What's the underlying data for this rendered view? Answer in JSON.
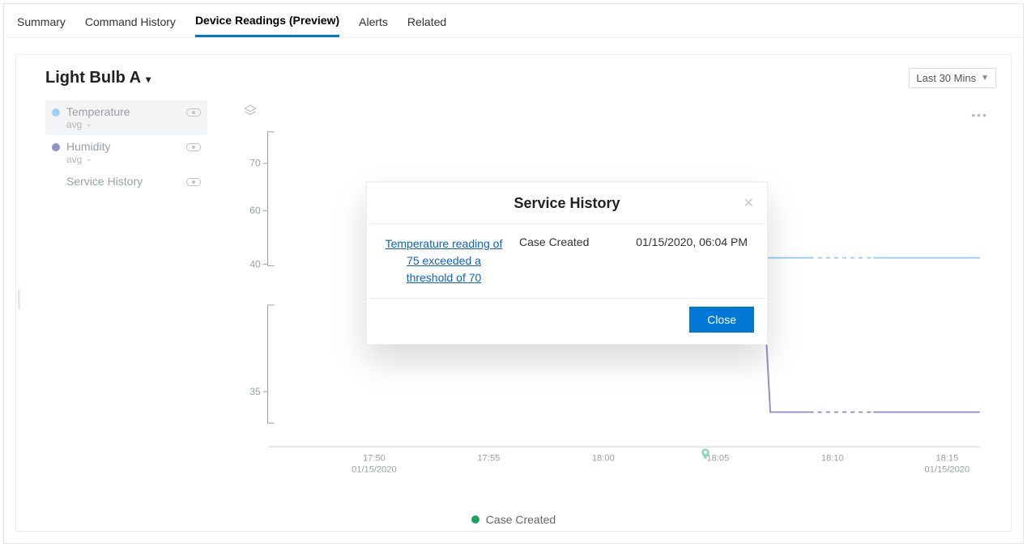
{
  "tabs": [
    {
      "label": "Summary"
    },
    {
      "label": "Command History"
    },
    {
      "label": "Device Readings (Preview)",
      "active": true
    },
    {
      "label": "Alerts"
    },
    {
      "label": "Related"
    }
  ],
  "device_title": "Light Bulb A",
  "time_range": "Last 30 Mins",
  "legend": {
    "temperature": {
      "label": "Temperature",
      "sub": "avg",
      "color": "#9bd2f2"
    },
    "humidity": {
      "label": "Humidity",
      "sub": "avg",
      "color": "#8f94c9"
    },
    "service_history": {
      "label": "Service History"
    }
  },
  "chart_data": {
    "type": "line",
    "xlabel": "",
    "ylabel": "",
    "x_ticks": [
      "17:50",
      "17:55",
      "18:00",
      "18:05",
      "18:10",
      "18:15"
    ],
    "x_date_start": "01/15/2020",
    "x_date_end": "01/15/2020",
    "y_ticks_upper": [
      70,
      60,
      40
    ],
    "y_ticks_lower": [
      35
    ],
    "series": [
      {
        "name": "Temperature",
        "color": "#9bd2f2",
        "points": [
          {
            "x": "18:07",
            "y": 45
          },
          {
            "x": "18:08",
            "y": 45,
            "gap_after": true
          },
          {
            "x": "18:12",
            "y": 45
          },
          {
            "x": "18:15",
            "y": 45
          }
        ]
      },
      {
        "name": "Humidity",
        "color": "#8f94c9",
        "points": [
          {
            "x": "18:04",
            "y": 37
          },
          {
            "x": "18:07",
            "y": 37
          },
          {
            "x": "18:07",
            "y": 34.2
          },
          {
            "x": "18:08",
            "y": 34.2,
            "gap_after": true
          },
          {
            "x": "18:12",
            "y": 34.2
          },
          {
            "x": "18:15",
            "y": 34.2
          }
        ]
      }
    ],
    "event_marker": {
      "x": "18:04",
      "label": "Case Created"
    },
    "legend_label": "Case Created"
  },
  "popover": {
    "title": "Service History",
    "link_text": "Temperature reading of 75 exceeded a threshold of 70",
    "status": "Case Created",
    "timestamp": "01/15/2020, 06:04 PM",
    "close_button": "Close"
  }
}
